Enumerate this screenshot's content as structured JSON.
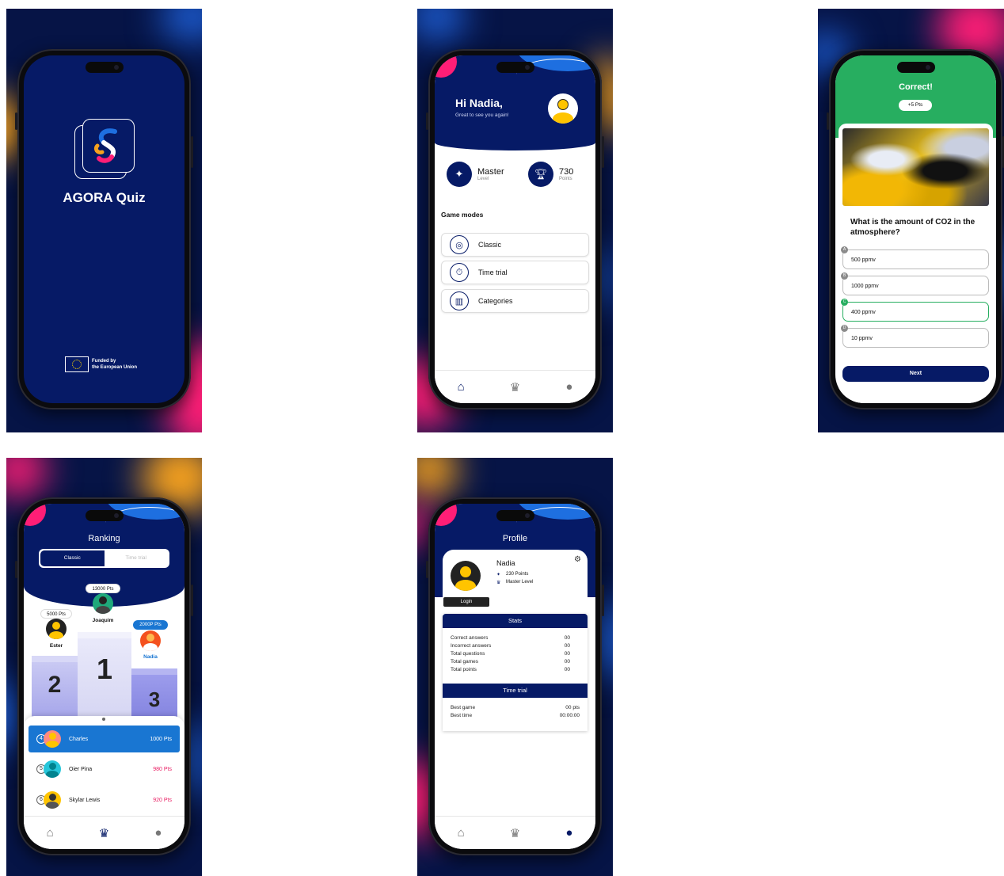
{
  "splash": {
    "app_title": "AGORA Quiz",
    "funding_line1": "Funded by",
    "funding_line2": "the European Union"
  },
  "home": {
    "greeting": "Hi Nadia,",
    "subtitle": "Great to see you again!",
    "level_value": "Master",
    "level_label": "Level",
    "points_value": "730",
    "points_label": "Points",
    "section_title": "Game modes",
    "modes": [
      {
        "label": "Classic",
        "icon": "target-icon"
      },
      {
        "label": "Time trial",
        "icon": "stopwatch-icon"
      },
      {
        "label": "Categories",
        "icon": "chart-icon"
      }
    ]
  },
  "quiz": {
    "result_title": "Correct!",
    "points_badge": "+5 Pts",
    "question": "What is the amount of CO2 in the atmosphere?",
    "answers": [
      {
        "letter": "A",
        "text": "500 ppmv",
        "correct": false
      },
      {
        "letter": "B",
        "text": "1000 ppmv",
        "correct": false
      },
      {
        "letter": "C",
        "text": "400 ppmv",
        "correct": true
      },
      {
        "letter": "D",
        "text": "10 ppmv",
        "correct": false
      }
    ],
    "next_label": "Next"
  },
  "ranking": {
    "title": "Ranking",
    "tab_classic": "Classic",
    "tab_time": "Time trial",
    "podium": [
      {
        "place": "1",
        "name": "Joaquim",
        "points": "13000 Pts"
      },
      {
        "place": "2",
        "name": "Ester",
        "points": "5000 Pts"
      },
      {
        "place": "3",
        "name": "Nadia",
        "points": "2000P Pts"
      }
    ],
    "list": [
      {
        "pos": "4",
        "name": "Charles",
        "points": "1000 Pts"
      },
      {
        "pos": "5",
        "name": "Oier Pina",
        "points": "980 Pts"
      },
      {
        "pos": "6",
        "name": "Skylar Lewis",
        "points": "920 Pts"
      }
    ]
  },
  "profile": {
    "title": "Profile",
    "name": "Nadia",
    "points": "230 Points",
    "level": "Master Level",
    "login_label": "Login",
    "stats_title": "Stats",
    "stats": [
      {
        "label": "Correct answers",
        "value": "00"
      },
      {
        "label": "Incorrect answers",
        "value": "00"
      },
      {
        "label": "Total questions",
        "value": "00"
      },
      {
        "label": "Total games",
        "value": "00"
      },
      {
        "label": "Total points",
        "value": "00"
      }
    ],
    "time_trial_title": "Time trial",
    "time_trial": [
      {
        "label": "Best game",
        "value": "00 pts"
      },
      {
        "label": "Best time",
        "value": "00:00:00"
      }
    ]
  },
  "colors": {
    "navy": "#061a66",
    "green": "#27ae60",
    "blue_highlight": "#1976d2",
    "pink_points": "#e91e63",
    "podium_purple": "#9c9cec"
  }
}
